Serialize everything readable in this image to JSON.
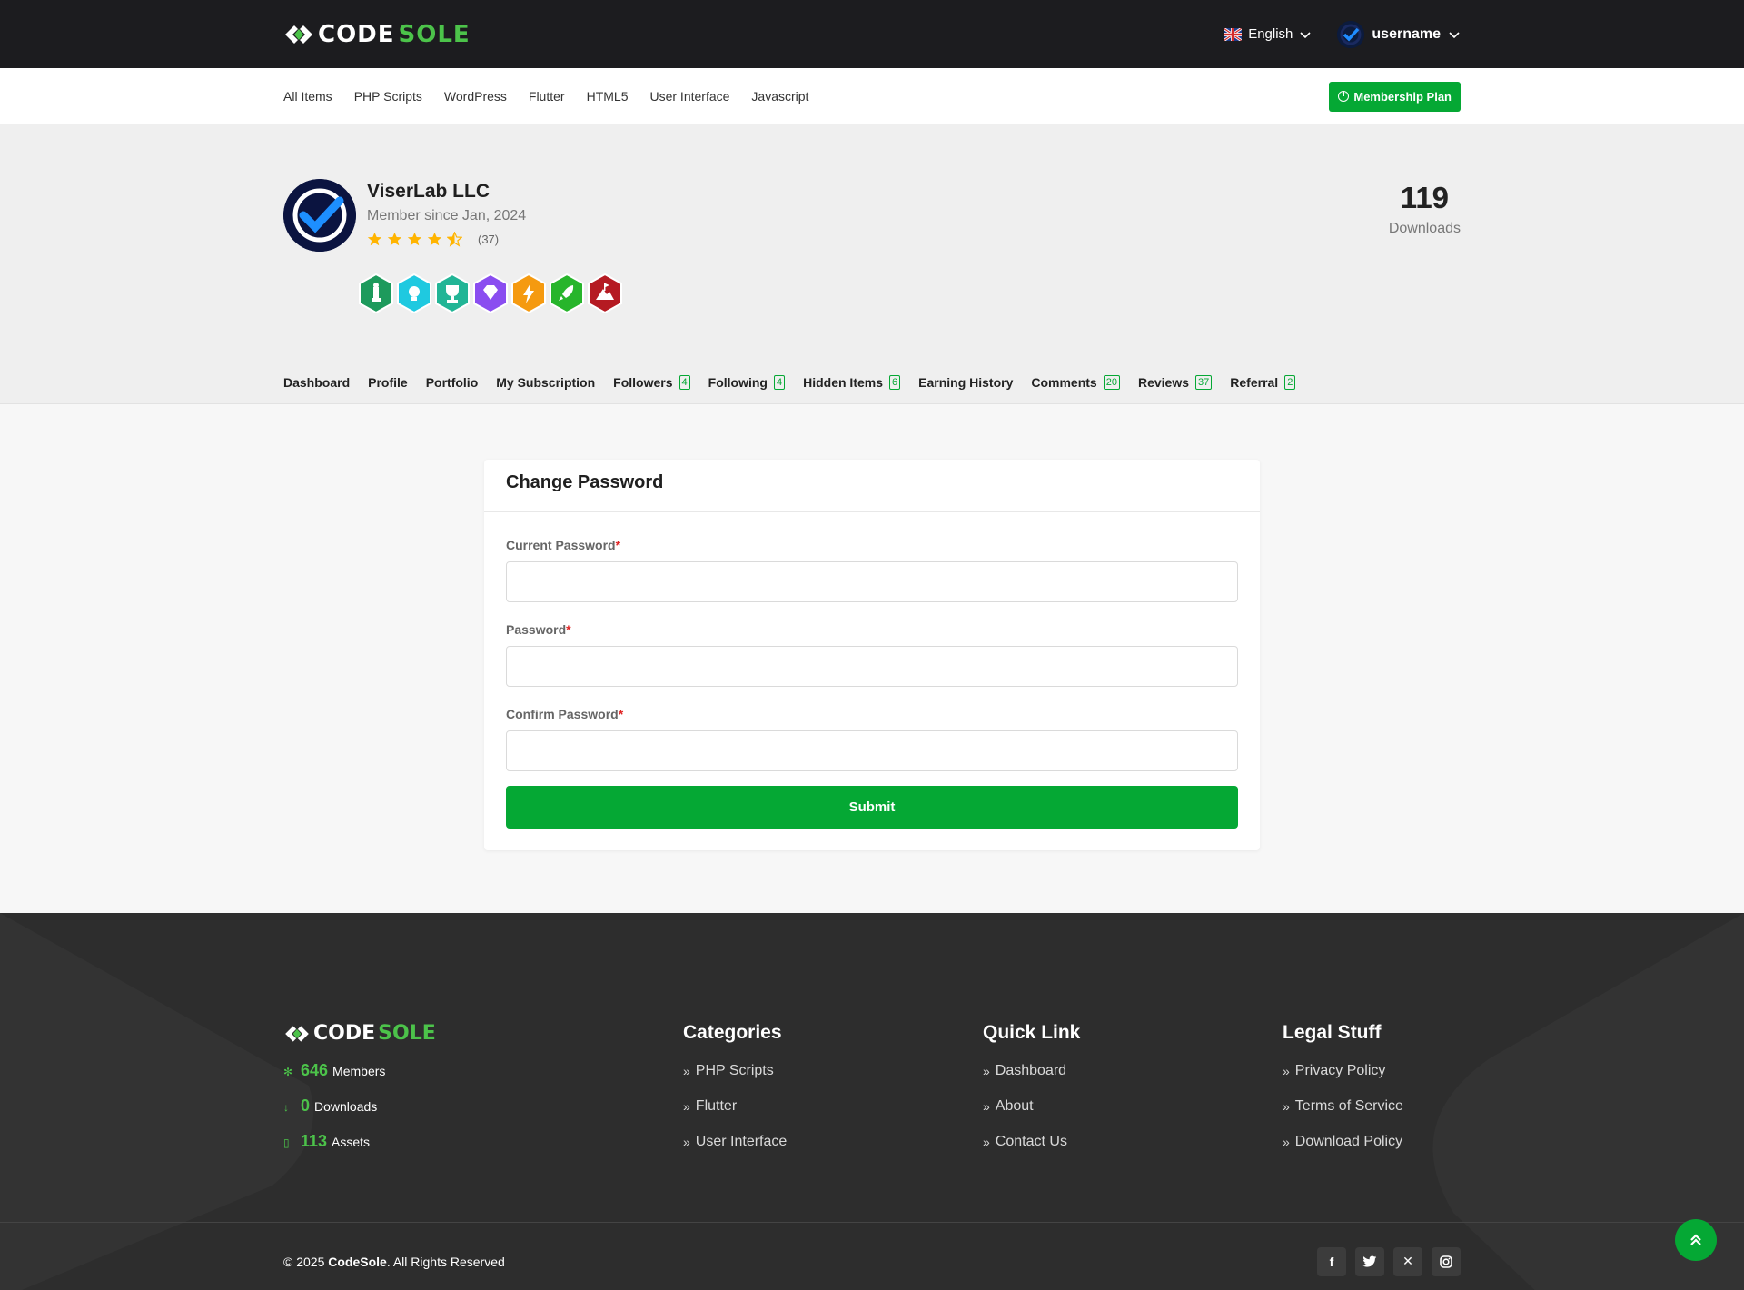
{
  "header": {
    "logo_code": "CODE",
    "logo_sole": "SOLE",
    "language": "English",
    "username": "username"
  },
  "nav": {
    "categories": [
      "All Items",
      "PHP Scripts",
      "WordPress",
      "Flutter",
      "HTML5",
      "User Interface",
      "Javascript"
    ],
    "membership_label": "Membership Plan"
  },
  "profile": {
    "name": "ViserLab LLC",
    "member_since": "Member since Jan, 2024",
    "rating": 4.5,
    "rating_count": "(37)",
    "downloads_value": "119",
    "downloads_label": "Downloads",
    "badge_icons": [
      "chess-badge-icon",
      "lightbulb-badge-icon",
      "trophy-badge-icon",
      "diamond-badge-icon",
      "lightning-badge-icon",
      "rocket-badge-icon",
      "mountain-badge-icon"
    ],
    "tabs": [
      {
        "label": "Dashboard",
        "count": ""
      },
      {
        "label": "Profile",
        "count": ""
      },
      {
        "label": "Portfolio",
        "count": ""
      },
      {
        "label": "My Subscription",
        "count": ""
      },
      {
        "label": "Followers",
        "count": "4"
      },
      {
        "label": "Following",
        "count": "4"
      },
      {
        "label": "Hidden Items",
        "count": "6"
      },
      {
        "label": "Earning History",
        "count": ""
      },
      {
        "label": "Comments",
        "count": "20"
      },
      {
        "label": "Reviews",
        "count": "37"
      },
      {
        "label": "Referral",
        "count": "2"
      }
    ]
  },
  "form": {
    "title": "Change Password",
    "fields": [
      {
        "label": "Current Password",
        "required": "*",
        "value": ""
      },
      {
        "label": "Password",
        "required": "*",
        "value": ""
      },
      {
        "label": "Confirm Password",
        "required": "*",
        "value": ""
      }
    ],
    "submit_label": "Submit"
  },
  "footer": {
    "stats": [
      {
        "value": "646",
        "label": "Members"
      },
      {
        "value": "0",
        "label": "Downloads"
      },
      {
        "value": "113",
        "label": "Assets"
      }
    ],
    "categories_title": "Categories",
    "categories": [
      "PHP Scripts",
      "Flutter",
      "User Interface"
    ],
    "quick_title": "Quick Link",
    "quick_links": [
      "Dashboard",
      "About",
      "Contact Us"
    ],
    "legal_title": "Legal Stuff",
    "legal_links": [
      "Privacy Policy",
      "Terms of Service",
      "Download Policy"
    ],
    "copyright_prefix": "© 2025 ",
    "copyright_brand": "CodeSole",
    "copyright_suffix": ". All Rights Reserved",
    "socials": [
      "facebook-icon",
      "twitter-icon",
      "x-icon",
      "instagram-icon"
    ]
  },
  "colors": {
    "brand_green": "#05a834",
    "logo_green": "#4cc34a",
    "topbar_bg": "#1c1c1f",
    "footer_bg": "#2d2d2d"
  }
}
